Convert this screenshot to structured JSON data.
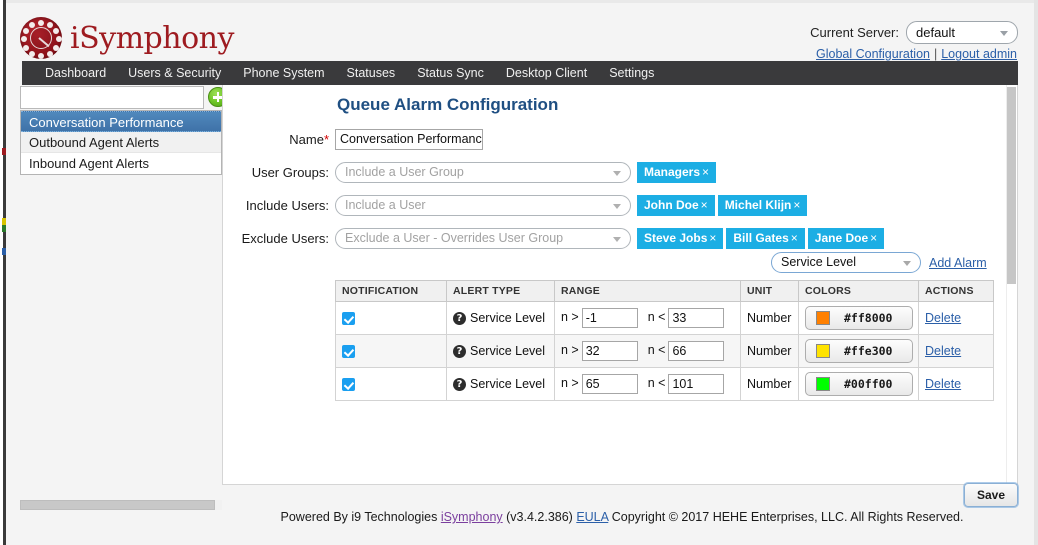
{
  "brand": {
    "name": "iSymphony",
    "logo_icon": "rotary-dial-logo"
  },
  "header": {
    "server_label": "Current Server:",
    "server_value": "default",
    "global_config_link": "Global Configuration",
    "separator": "|",
    "logout_link": "Logout admin"
  },
  "nav": {
    "items": [
      {
        "label": "Dashboard"
      },
      {
        "label": "Users & Security"
      },
      {
        "label": "Phone System"
      },
      {
        "label": "Statuses"
      },
      {
        "label": "Status Sync"
      },
      {
        "label": "Desktop Client"
      },
      {
        "label": "Settings"
      }
    ]
  },
  "sidebar": {
    "search_value": "",
    "search_placeholder": "",
    "add_button_icon": "plus-circle-icon",
    "items": [
      {
        "label": "Conversation Performance",
        "selected": true
      },
      {
        "label": "Outbound Agent Alerts",
        "selected": false
      },
      {
        "label": "Inbound Agent Alerts",
        "selected": false
      }
    ]
  },
  "main": {
    "title": "Queue Alarm Configuration",
    "fields": {
      "name_label": "Name",
      "name_required_marker": "*",
      "name_value": "Conversation Performanc",
      "user_groups_label": "User Groups:",
      "user_groups_placeholder": "Include a User Group",
      "user_groups_tags": [
        "Managers"
      ],
      "include_users_label": "Include Users:",
      "include_users_placeholder": "Include a User",
      "include_users_tags": [
        "John Doe",
        "Michel Klijn"
      ],
      "exclude_users_label": "Exclude Users:",
      "exclude_users_placeholder": "Exclude a User - Overrides User Group",
      "exclude_users_tags": [
        "Steve Jobs",
        "Bill Gates",
        "Jane Doe"
      ],
      "tag_remove_glyph": "×"
    },
    "alarm_selector": {
      "selected": "Service Level",
      "add_link": "Add Alarm"
    },
    "table": {
      "columns": [
        "NOTIFICATION",
        "ALERT TYPE",
        "RANGE",
        "UNIT",
        "COLORS",
        "ACTIONS"
      ],
      "rows": [
        {
          "notification_checked": true,
          "alert_type": "Service Level",
          "alert_type_icon": "help-circle-icon",
          "op_gt": "n >",
          "min": "-1",
          "op_lt": "n <",
          "max": "33",
          "unit": "Number",
          "color": "#ff8000",
          "color_label": "#ff8000",
          "action": "Delete"
        },
        {
          "notification_checked": true,
          "alert_type": "Service Level",
          "alert_type_icon": "help-circle-icon",
          "op_gt": "n >",
          "min": "32",
          "op_lt": "n <",
          "max": "66",
          "unit": "Number",
          "color": "#ffe300",
          "color_label": "#ffe300",
          "action": "Delete"
        },
        {
          "notification_checked": true,
          "alert_type": "Service Level",
          "alert_type_icon": "help-circle-icon",
          "op_gt": "n >",
          "min": "65",
          "op_lt": "n <",
          "max": "101",
          "unit": "Number",
          "color": "#00ff00",
          "color_label": "#00ff00",
          "action": "Delete"
        }
      ]
    },
    "save_label": "Save"
  },
  "footer": {
    "prefix": "Powered By i9 Technologies ",
    "isymphony_link": "iSymphony",
    "version": " (v3.4.2.386) ",
    "eula_link": "EULA",
    "suffix": " Copyright © 2017 HEHE Enterprises, LLC. All Rights Reserved."
  },
  "colors": {
    "brand_red": "#9e1b20",
    "nav_bg": "#3a3a3c",
    "title_blue": "#1f4f82",
    "tag_blue": "#1caee4",
    "link_blue": "#2b5fa8",
    "selected_item_blue": "#4a7fb5",
    "checkbox_blue": "#1a9ff0"
  }
}
